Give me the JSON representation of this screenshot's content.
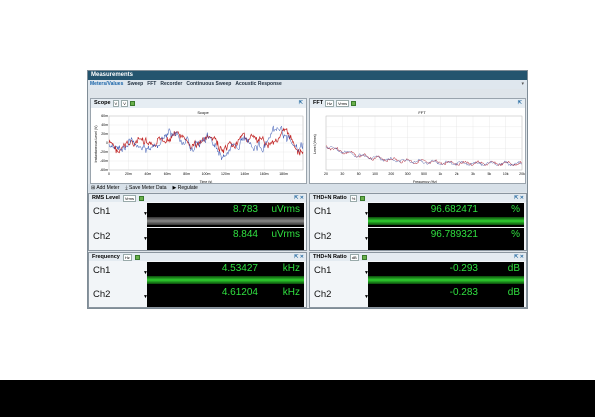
{
  "window": {
    "title": "Measurements"
  },
  "tabs": [
    "Meters/Values",
    "Sweep",
    "FFT",
    "Recorder",
    "Continuous Sweep",
    "Acoustic Response"
  ],
  "scope": {
    "label": "Scope",
    "sel1": "V",
    "sel2": "V",
    "chart_title": "Scope",
    "ylabel": "Instantaneous Level (V)",
    "xlabel": "Time (s)",
    "yticks": [
      "60m",
      "40m",
      "20m",
      "0",
      "-20m",
      "-40m",
      "-60m"
    ],
    "xticks": [
      "0",
      "20m",
      "40m",
      "60m",
      "80m",
      "100m",
      "120m",
      "140m",
      "160m",
      "180m"
    ]
  },
  "fft": {
    "label": "FFT",
    "sel1": "Hz",
    "sel2": "Vrms",
    "chart_title": "FFT",
    "ylabel": "Level (Vrms)",
    "xlabel": "Frequency (Hz)",
    "xticks": [
      "20",
      "30",
      "50",
      "100",
      "200",
      "300",
      "500",
      "1k",
      "2k",
      "3k",
      "5k",
      "10k",
      "20k"
    ]
  },
  "meter_toolbar": {
    "add": "Add Meter",
    "save": "Save Meter Data",
    "regulate": "Regulate"
  },
  "meters": [
    {
      "title": "RMS Level",
      "unit_sel": "Vrms",
      "ch1": "Ch1",
      "ch2": "Ch2",
      "v1": "8.783",
      "v2": "8.844",
      "u1": "uVrms",
      "u2": "uVrms",
      "bar": "grey"
    },
    {
      "title": "THD+N Ratio",
      "unit_sel": "%",
      "ch1": "Ch1",
      "ch2": "Ch2",
      "v1": "96.682471",
      "v2": "96.789321",
      "u1": "%",
      "u2": "%",
      "bar": "green"
    },
    {
      "title": "Frequency",
      "unit_sel": "Hz",
      "ch1": "Ch1",
      "ch2": "Ch2",
      "v1": "4.53427",
      "v2": "4.61204",
      "u1": "kHz",
      "u2": "kHz",
      "bar": "green"
    },
    {
      "title": "THD+N Ratio",
      "unit_sel": "dB",
      "ch1": "Ch1",
      "ch2": "Ch2",
      "v1": "-0.293",
      "v2": "-0.283",
      "u1": "dB",
      "u2": "dB",
      "bar": "green"
    }
  ]
}
